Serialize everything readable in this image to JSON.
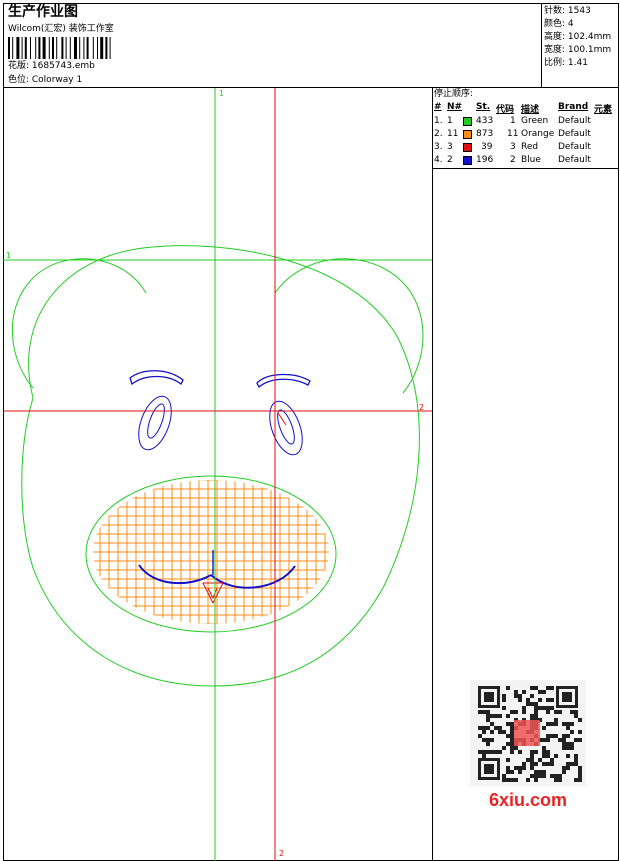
{
  "header": {
    "title": "生产作业图",
    "company": "Wilcom(汇宏) 装饰工作室",
    "design_file_label": "花版: 1685743.emb",
    "colorway_label": "色位: Colorway 1"
  },
  "stats": {
    "stitches": "针数: 1543",
    "colors": "颜色: 4",
    "height": "高度: 102.4mm",
    "width": "宽度: 100.1mm",
    "scale": "比例: 1.41"
  },
  "stop_sequence": {
    "title": "停止顺序:",
    "headers": [
      "#",
      "N#",
      "St.",
      "代码",
      "描述",
      "Brand",
      "元素"
    ],
    "rows": [
      {
        "num": "1.",
        "n": "1",
        "st": "433",
        "code": "1",
        "desc": "Green",
        "brand": "Default",
        "color": "#22cc22"
      },
      {
        "num": "2.",
        "n": "11",
        "st": "873",
        "code": "11",
        "desc": "Orange",
        "brand": "Default",
        "color": "#ff8c1a"
      },
      {
        "num": "3.",
        "n": "3",
        "st": "39",
        "code": "3",
        "desc": "Red",
        "brand": "Default",
        "color": "#dd1111"
      },
      {
        "num": "4.",
        "n": "2",
        "st": "196",
        "code": "2",
        "desc": "Blue",
        "brand": "Default",
        "color": "#1111cc"
      }
    ]
  },
  "guides": {
    "green_top": "1",
    "green_left": "1",
    "red_right": "2",
    "red_bottom": "2"
  },
  "colors": {
    "green": "#22cc22",
    "red": "#dd1111",
    "orange": "#ff8c1a",
    "blue": "#1111cc"
  },
  "watermark": {
    "site": "6xiu.com"
  }
}
